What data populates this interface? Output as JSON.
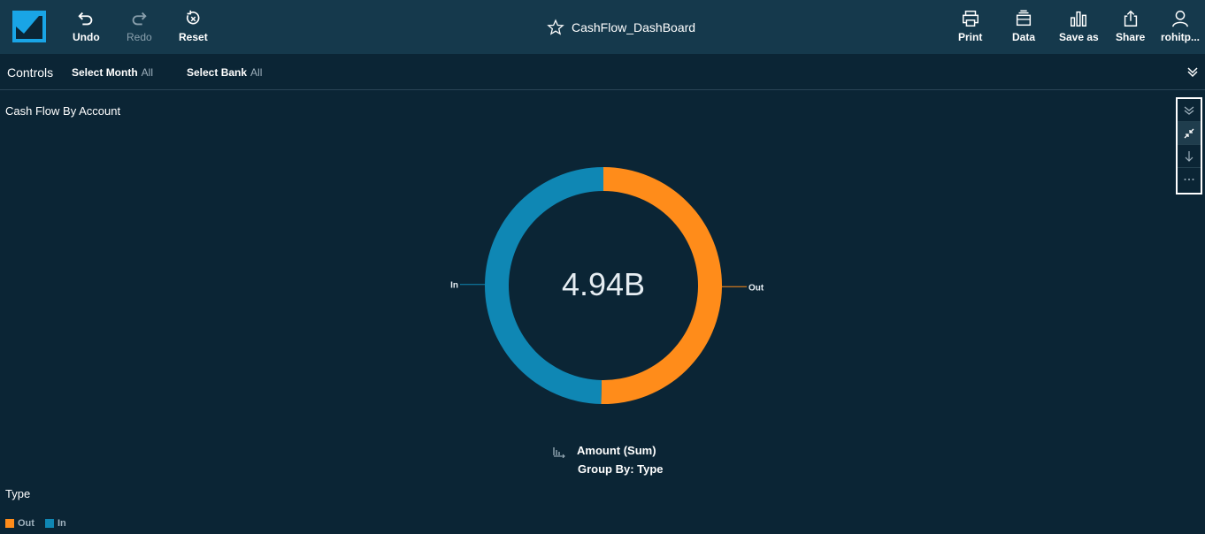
{
  "toolbar": {
    "undo_label": "Undo",
    "redo_label": "Redo",
    "reset_label": "Reset",
    "print_label": "Print",
    "data_label": "Data",
    "save_as_label": "Save as",
    "share_label": "Share",
    "user_label": "rohitp..."
  },
  "dashboard": {
    "title": "CashFlow_DashBoard"
  },
  "controls": {
    "label": "Controls",
    "filters": [
      {
        "name": "Select Month",
        "value": "All"
      },
      {
        "name": "Select Bank",
        "value": "All"
      }
    ]
  },
  "visual": {
    "title": "Cash Flow By Account",
    "center_value": "4.94B",
    "field_value": "Amount (Sum)",
    "group_by": "Group By: Type",
    "legend_title": "Type"
  },
  "colors": {
    "out": "#ff8c1a",
    "in": "#0f87b4",
    "topbar": "#15394c",
    "background": "#0b2535"
  },
  "chart_data": {
    "type": "pie",
    "donut": true,
    "categories": [
      "Out",
      "In"
    ],
    "values": [
      50.3,
      49.7
    ],
    "center_label": "4.94B",
    "legend": [
      "Out",
      "In"
    ]
  }
}
